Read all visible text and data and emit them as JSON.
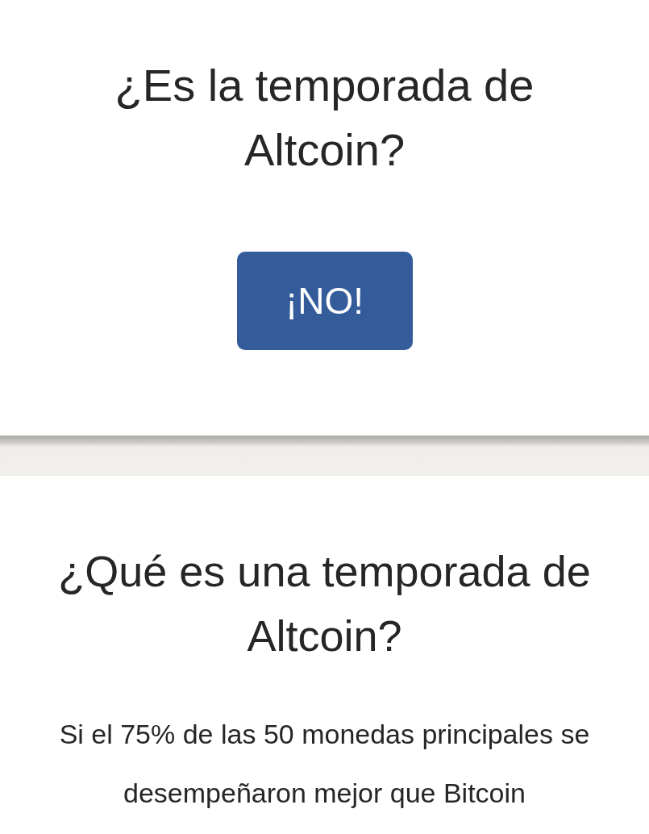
{
  "hero": {
    "title": "¿Es la temporada de Altcoin?",
    "answer": "¡NO!"
  },
  "info": {
    "heading": "¿Qué es una temporada de Altcoin?",
    "text": "Si el 75% de las 50 monedas principales se desempeñaron mejor que Bitcoin"
  }
}
